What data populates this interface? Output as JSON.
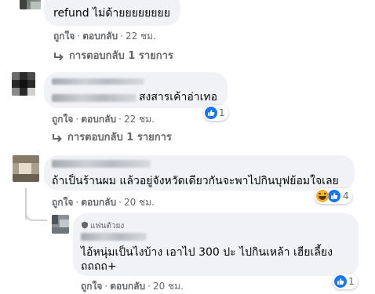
{
  "comments": [
    {
      "text": "refund ไม่ด้ายยยยยยยย",
      "like_label": "ถูกใจ",
      "reply_label": "ตอบกลับ",
      "time": "22 ชม.",
      "replies_label": "การตอบกลับ 1 รายการ"
    },
    {
      "text": "สงสารเค้าอ่าเทอ",
      "like_label": "ถูกใจ",
      "reply_label": "ตอบกลับ",
      "time": "22 ชม.",
      "reaction_count": "1",
      "replies_label": "การตอบกลับ 1 รายการ"
    },
    {
      "text": "ถ้าเป็นร้านผม แล้วอยู่จังหวัดเดียวกันจะพาไปกินบุฟย้อมใจเลย",
      "like_label": "ถูกใจ",
      "reply_label": "ตอบกลับ",
      "time": "20 ชม.",
      "reaction_count": "4"
    }
  ],
  "reply": {
    "badge": "แฟนตัวยง",
    "text": "ไอ้หนุ่มเป็นไงบ้าง เอาไป 300 ปะ ไปกินเหล้า เฮียเลี้ยง ถถถถ+",
    "like_label": "ถูกใจ",
    "reply_label": "ตอบกลับ",
    "time": "20 ชม.",
    "reaction_count": "1"
  },
  "colors": {
    "bubble": "#f0f2f5",
    "secondary_text": "#65676b",
    "like_blue": "#1877f2",
    "haha_yellow": "#f7b125"
  },
  "icons": [
    "reply-arrow-icon",
    "like-reaction-icon",
    "haha-reaction-icon",
    "fan-badge-icon"
  ]
}
